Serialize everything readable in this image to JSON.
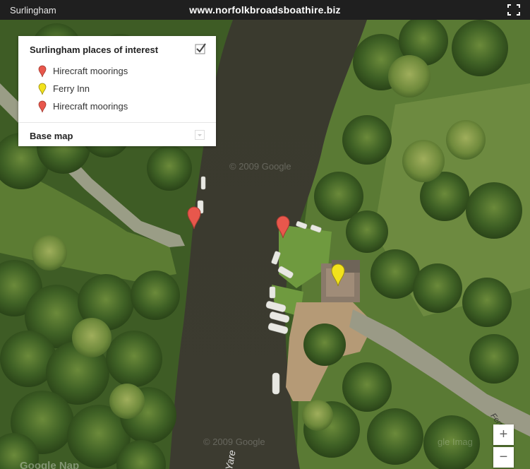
{
  "header": {
    "map_title": "Surlingham",
    "site_name": "www.norfolkbroadsboathire.biz",
    "fullscreen_icon": "fullscreen-icon"
  },
  "legend": {
    "title": "Surlingham places of interest",
    "checkbox_checked": true,
    "items": [
      {
        "label": "Hirecraft moorings",
        "pin_color": "#e8574c"
      },
      {
        "label": "Ferry Inn",
        "pin_color": "#f2e21c"
      },
      {
        "label": "Hirecraft moorings",
        "pin_color": "#e8574c"
      }
    ],
    "base_map_label": "Base map"
  },
  "map": {
    "watermark_1": "© 2009 Google",
    "watermark_2": "© 2009 Google",
    "watermark_3": "gle Imag",
    "river_label": "Yare",
    "road_label": "Ferry Rd",
    "attribution": "Google Nap"
  },
  "zoom": {
    "in_label": "+",
    "out_label": "−"
  },
  "colors": {
    "marker_red": "#e8574c",
    "marker_yellow": "#f2e21c",
    "river": "#3a3b2f",
    "forest": "#3b5a24",
    "grass": "#5d7a35"
  }
}
